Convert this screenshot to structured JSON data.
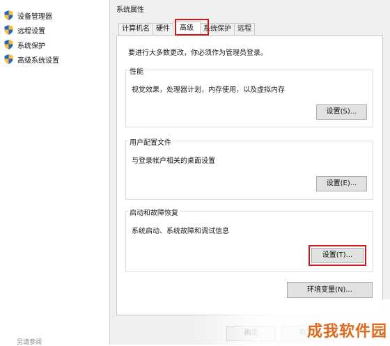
{
  "sidebar": {
    "items": [
      {
        "label": "设备管理器",
        "icon": "shield-icon"
      },
      {
        "label": "远程设置",
        "icon": "shield-icon"
      },
      {
        "label": "系统保护",
        "icon": "shield-icon"
      },
      {
        "label": "高级系统设置",
        "icon": "shield-icon"
      }
    ],
    "see_also": "另请参阅"
  },
  "dialog": {
    "title": "系统属性",
    "tabs": [
      {
        "label": "计算机名",
        "active": false
      },
      {
        "label": "硬件",
        "active": false
      },
      {
        "label": "高级",
        "active": true
      },
      {
        "label": "系统保护",
        "active": false
      },
      {
        "label": "远程",
        "active": false
      }
    ],
    "admin_note": "要进行大多数更改，你必须作为管理员登录。",
    "performance": {
      "title": "性能",
      "description": "视觉效果，处理器计划，内存使用，以及虚拟内存",
      "button": "设置(S)..."
    },
    "user_profiles": {
      "title": "用户配置文件",
      "description": "与登录帐户相关的桌面设置",
      "button": "设置(E)..."
    },
    "startup_recovery": {
      "title": "启动和故障恢复",
      "description": "系统启动、系统故障和调试信息",
      "button": "设置(T)..."
    },
    "env_button": "环境变量(N)...",
    "ok_button": "确定",
    "cancel_button": "取消"
  },
  "watermark": "成我软件园",
  "colors": {
    "highlight": "#d0181c",
    "shield_blue": "#2b62c8",
    "shield_yellow": "#f2c230",
    "watermark": "#e06a1d"
  }
}
